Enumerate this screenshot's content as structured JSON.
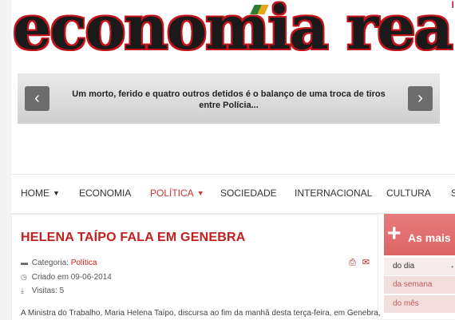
{
  "site": {
    "logo": "economia real"
  },
  "news_ticker": {
    "headline": "Um morto, ferido e quatro outros detidos é o balanço de uma troca de tiros entre Polícia..."
  },
  "nav": {
    "items": [
      {
        "label": "HOME",
        "dropdown": true,
        "active": false
      },
      {
        "label": "ECONOMIA",
        "dropdown": false,
        "active": false
      },
      {
        "label": "POLÍTICA",
        "dropdown": true,
        "active": true
      },
      {
        "label": "SOCIEDADE",
        "dropdown": false,
        "active": false
      },
      {
        "label": "INTERNACIONAL",
        "dropdown": false,
        "active": false
      },
      {
        "label": "CULTURA",
        "dropdown": false,
        "active": false
      },
      {
        "label": "S",
        "dropdown": false,
        "active": false
      }
    ]
  },
  "article": {
    "title": "HELENA TAÍPO FALA EM GENEBRA",
    "category_label": "Categoria:",
    "category": "Política",
    "created": "Criado em 09-06-2014",
    "visits": "Visitas: 5",
    "intro": "A Ministra do Trabalho, Maria Helena Taípo, discursa ao fim da manhã desta terça-feira, em Genebra,"
  },
  "sidebar": {
    "title": "As mais",
    "tabs": [
      "do dia",
      "da semana",
      "do mês"
    ]
  },
  "colors": {
    "accent": "#c41e1e",
    "sidebar": "#e07070"
  }
}
